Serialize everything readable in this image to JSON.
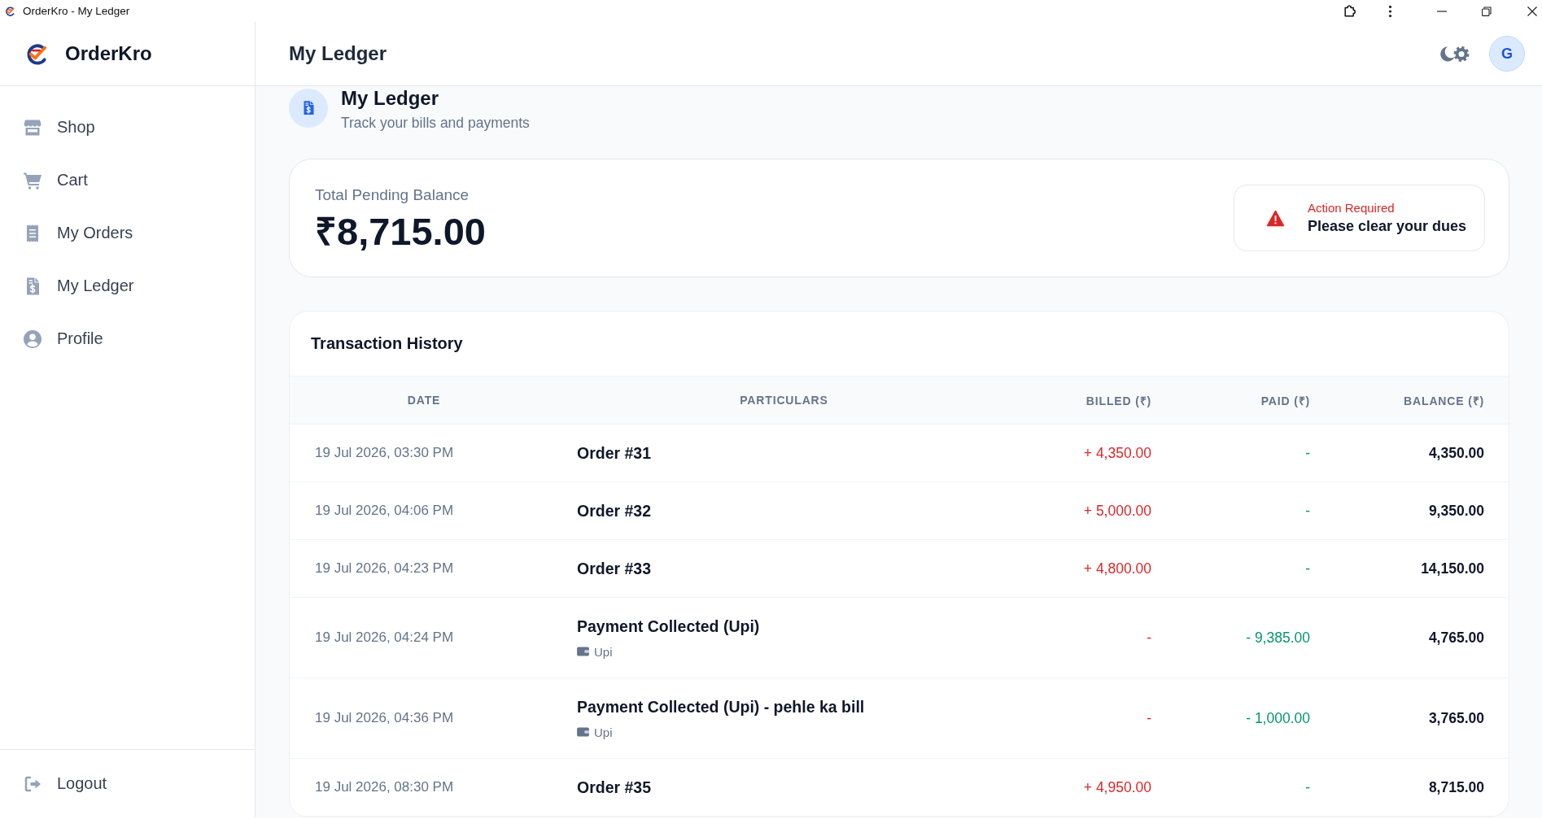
{
  "window": {
    "title": "OrderKro - My Ledger"
  },
  "sidebar": {
    "brand": "OrderKro",
    "items": [
      "Shop",
      "Cart",
      "My Orders",
      "My Ledger",
      "Profile"
    ],
    "footer_item": "Logout"
  },
  "header": {
    "title": "My Ledger",
    "avatar_initial": "G"
  },
  "page_heading": {
    "title": "My Ledger",
    "subtitle": "Track your bills and payments"
  },
  "balance_card": {
    "label": "Total Pending Balance",
    "amount": "₹8,715.00",
    "alert": {
      "title": "Action Required",
      "message": "Please clear your dues"
    }
  },
  "transactions": {
    "title": "Transaction History",
    "columns": [
      "DATE",
      "PARTICULARS",
      "BILLED (₹)",
      "PAID (₹)",
      "BALANCE (₹)"
    ],
    "rows": [
      {
        "date": "19 Jul 2026, 03:30 PM",
        "particulars": "Order #31",
        "billed": "+ 4,350.00",
        "paid": "-",
        "balance": "4,350.00"
      },
      {
        "date": "19 Jul 2026, 04:06 PM",
        "particulars": "Order #32",
        "billed": "+ 5,000.00",
        "paid": "-",
        "balance": "9,350.00"
      },
      {
        "date": "19 Jul 2026, 04:23 PM",
        "particulars": "Order #33",
        "billed": "+ 4,800.00",
        "paid": "-",
        "balance": "14,150.00"
      },
      {
        "date": "19 Jul 2026, 04:24 PM",
        "particulars": "Payment Collected (Upi)",
        "method": "Upi",
        "billed": "-",
        "paid": "- 9,385.00",
        "balance": "4,765.00"
      },
      {
        "date": "19 Jul 2026, 04:36 PM",
        "particulars": "Payment Collected (Upi) - pehle ka bill",
        "method": "Upi",
        "billed": "-",
        "paid": "- 1,000.00",
        "balance": "3,765.00"
      },
      {
        "date": "19 Jul 2026, 08:30 PM",
        "particulars": "Order #35",
        "billed": "+ 4,950.00",
        "paid": "-",
        "balance": "8,715.00"
      }
    ]
  }
}
